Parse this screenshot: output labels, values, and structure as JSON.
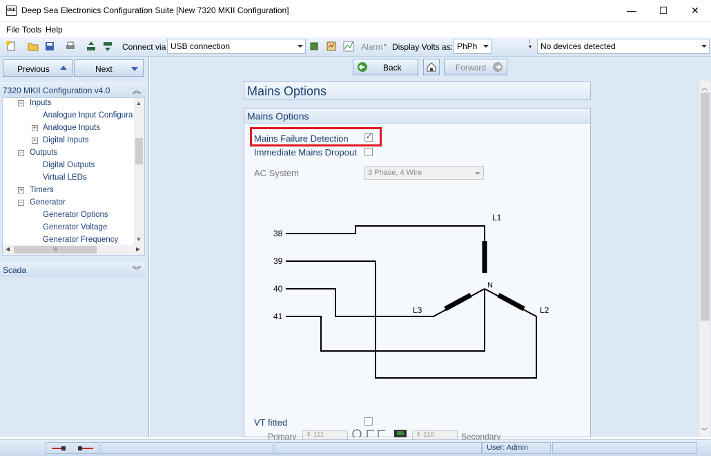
{
  "window": {
    "title": "Deep Sea Electronics Configuration Suite [New 7320 MKII Configuration]",
    "app_icon_text": "DSE",
    "minimize": "—",
    "maximize": "☐",
    "close": "✕"
  },
  "menu": [
    "File",
    "Tools",
    "Help"
  ],
  "toolbar": {
    "connect_via_label": "Connect via",
    "connect_via_value": "USB connection",
    "alarm_label": "Alarm",
    "display_volts_label": "Display Volts as:",
    "display_volts_value": "PhPh",
    "devices_value": "No devices detected"
  },
  "nav": {
    "previous_label": "Previous",
    "next_label": "Next",
    "config_header": "7320 MKII Configuration v4.0",
    "scada_header": "Scada",
    "tree": [
      {
        "label": "Inputs",
        "exp": "⊟"
      },
      {
        "label": "Analogue Input Configura",
        "exp": ""
      },
      {
        "label": "Analogue Inputs",
        "exp": "⊞"
      },
      {
        "label": "Digital Inputs",
        "exp": "⊞"
      },
      {
        "label": "Outputs",
        "exp": "⊟"
      },
      {
        "label": "Digital Outputs",
        "exp": ""
      },
      {
        "label": "Virtual LEDs",
        "exp": ""
      },
      {
        "label": "Timers",
        "exp": "⊞"
      },
      {
        "label": "Generator",
        "exp": "⊟"
      },
      {
        "label": "Generator Options",
        "exp": ""
      },
      {
        "label": "Generator Voltage",
        "exp": ""
      },
      {
        "label": "Generator Frequency",
        "exp": ""
      }
    ],
    "hscroll_grip": "III"
  },
  "main": {
    "back_label": "Back",
    "forward_label": "Forward",
    "section_title": "Mains Options",
    "group_title": "Mains Options",
    "mains_failure_detection_label": "Mains Failure Detection",
    "mains_failure_detection_checked": true,
    "immediate_mains_dropout_label": "Immediate Mains Dropout",
    "immediate_mains_dropout_checked": false,
    "ac_system_label": "AC System",
    "ac_system_value": "3 Phase, 4 Wire",
    "vt_fitted_label": "VT fitted",
    "vt_fitted_checked": false,
    "primary_label": "Primary",
    "primary_value": "111",
    "secondary_label": "Secondary",
    "secondary_value": "110"
  },
  "diagram": {
    "terminals": [
      "38",
      "39",
      "40",
      "41"
    ],
    "phase_labels": {
      "l1": "L1",
      "l2": "L2",
      "l3": "L3",
      "n": "N"
    }
  },
  "status": {
    "user": "User: Admin"
  },
  "colors": {
    "highlight": "#e0161f",
    "accent_text": "#1c3f72"
  }
}
